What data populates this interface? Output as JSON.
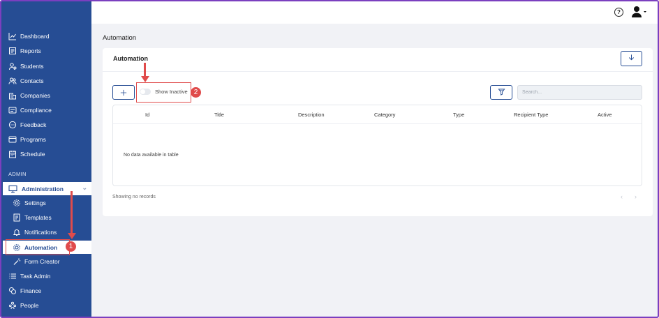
{
  "sidebar": {
    "items": [
      {
        "label": "Dashboard",
        "icon": "chart-line-icon"
      },
      {
        "label": "Reports",
        "icon": "report-icon"
      },
      {
        "label": "Students",
        "icon": "students-icon"
      },
      {
        "label": "Contacts",
        "icon": "contacts-icon"
      },
      {
        "label": "Companies",
        "icon": "companies-icon"
      },
      {
        "label": "Compliance",
        "icon": "compliance-icon"
      },
      {
        "label": "Feedback",
        "icon": "feedback-icon"
      },
      {
        "label": "Programs",
        "icon": "programs-icon"
      },
      {
        "label": "Schedule",
        "icon": "schedule-icon"
      }
    ],
    "admin_section_label": "ADMIN",
    "administration_label": "Administration",
    "sub_items": [
      {
        "label": "Settings",
        "icon": "gear-icon"
      },
      {
        "label": "Templates",
        "icon": "template-icon"
      },
      {
        "label": "Notifications",
        "icon": "bell-icon"
      },
      {
        "label": "Automation",
        "icon": "gear-icon"
      },
      {
        "label": "Form Creator",
        "icon": "wand-icon"
      }
    ],
    "bottom_items": [
      {
        "label": "Task Admin",
        "icon": "list-icon"
      },
      {
        "label": "Finance",
        "icon": "finance-icon"
      },
      {
        "label": "People",
        "icon": "people-icon"
      }
    ]
  },
  "page": {
    "title": "Automation",
    "card_title": "Automation",
    "show_inactive_label": "Show Inactive",
    "search_placeholder": "Search..."
  },
  "table": {
    "columns": [
      "Id",
      "Title",
      "Description",
      "Category",
      "Type",
      "Recipient Type",
      "Active"
    ],
    "empty_text": "No data available in table",
    "footer": "Showing no records"
  },
  "annotations": {
    "badge_1": "1",
    "badge_2": "2"
  },
  "colors": {
    "sidebar": "#264d94",
    "accent": "#264d94",
    "annotation": "#e04b4b",
    "frame_border": "#7b3fbf"
  }
}
